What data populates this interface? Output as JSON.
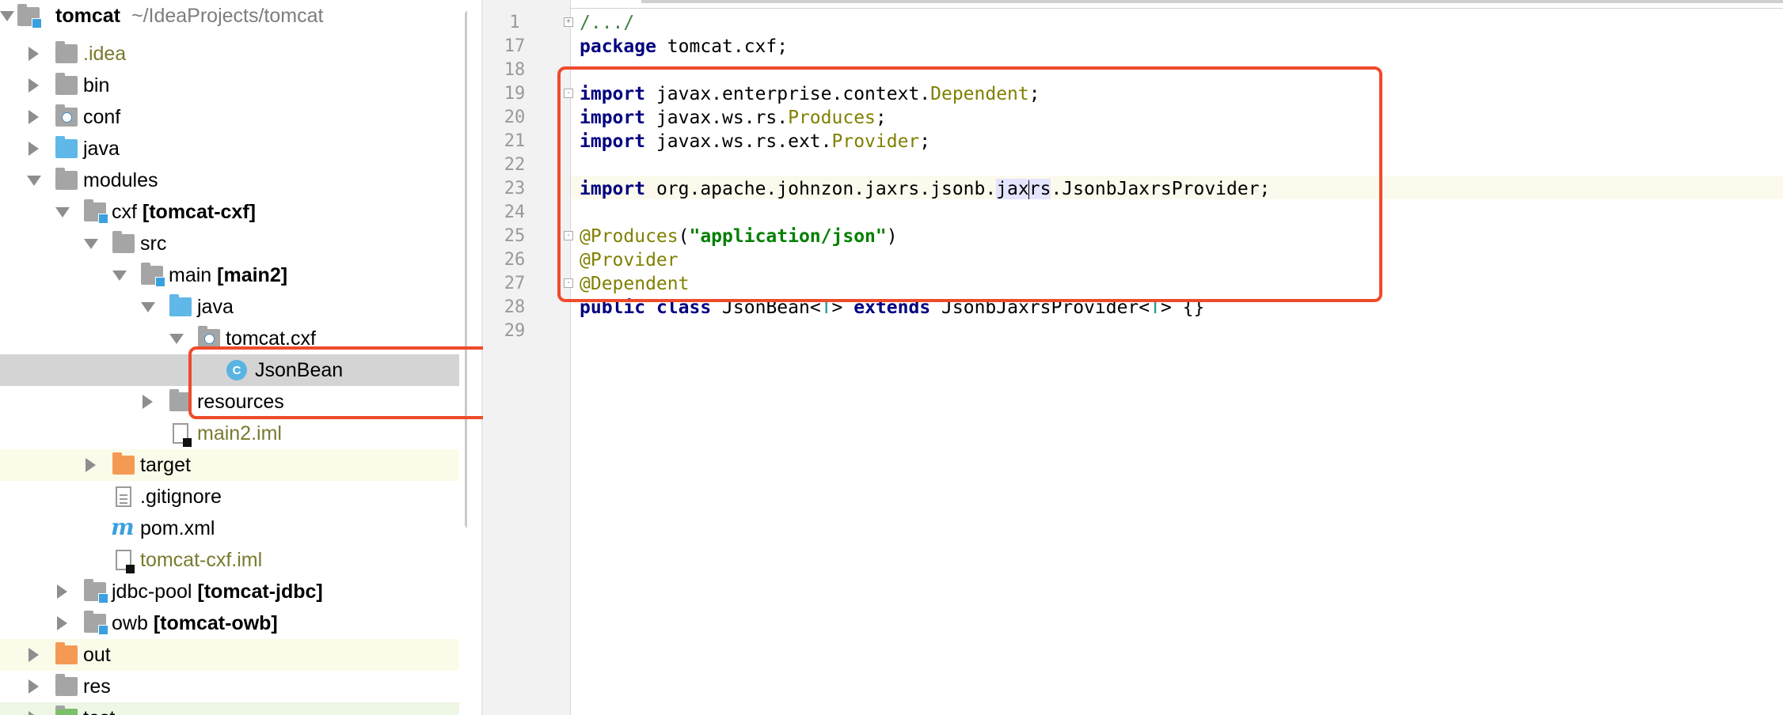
{
  "project_tree": {
    "items": [
      {
        "label": "tomcat",
        "path": "~/IdeaProjects/tomcat"
      },
      {
        "label": ".idea"
      },
      {
        "label": "bin"
      },
      {
        "label": "conf"
      },
      {
        "label": "java"
      },
      {
        "label": "modules"
      },
      {
        "label": "cxf",
        "suffix": "[tomcat-cxf]"
      },
      {
        "label": "src"
      },
      {
        "label": "main",
        "suffix": "[main2]"
      },
      {
        "label": "java"
      },
      {
        "label": "tomcat.cxf"
      },
      {
        "label": "JsonBean",
        "icon_letter": "C"
      },
      {
        "label": "resources"
      },
      {
        "label": "main2.iml"
      },
      {
        "label": "target"
      },
      {
        "label": ".gitignore"
      },
      {
        "label": "pom.xml",
        "icon_letter": "m"
      },
      {
        "label": "tomcat-cxf.iml"
      },
      {
        "label": "jdbc-pool",
        "suffix": "[tomcat-jdbc]"
      },
      {
        "label": "owb",
        "suffix": "[tomcat-owb]"
      },
      {
        "label": "out"
      },
      {
        "label": "res"
      },
      {
        "label": "test"
      }
    ]
  },
  "editor": {
    "line_numbers": [
      "1",
      "17",
      "18",
      "19",
      "20",
      "21",
      "22",
      "23",
      "24",
      "25",
      "26",
      "27",
      "28",
      "29"
    ],
    "code": {
      "l1": "/.../",
      "kw_package": "package",
      "l17_rest": " tomcat.cxf;",
      "kw_import": "import",
      "l19_pkg": " javax.enterprise.context.",
      "l19_cls": "Dependent",
      "l20_pkg": " javax.ws.rs.",
      "l20_cls": "Produces",
      "l21_pkg": " javax.ws.rs.ext.",
      "l21_cls": "Provider",
      "l23_pre": " org.apache.johnzon.jaxrs.jsonb.",
      "l23_sel1": "jax",
      "l23_sel2": "rs",
      "l23_post": ".JsonbJaxrsProvider;",
      "l25_ann": "@Produces",
      "l25_open": "(",
      "l25_str": "\"application/json\"",
      "l25_close": ")",
      "l26_ann": "@Provider",
      "l27_ann": "@Dependent",
      "kw_public": "public",
      "kw_class": "class",
      "l28_name": " JsonBean<",
      "l28_T1": "T",
      "l28_mid": "> ",
      "kw_extends": "extends",
      "l28_sup": " JsonbJaxrsProvider<",
      "l28_T2": "T",
      "l28_end": "> {}",
      "semi": ";"
    }
  },
  "colors": {
    "keyword": "#000080",
    "annotation": "#808000",
    "string": "#008000",
    "highlight_box": "#ee4b2b"
  }
}
